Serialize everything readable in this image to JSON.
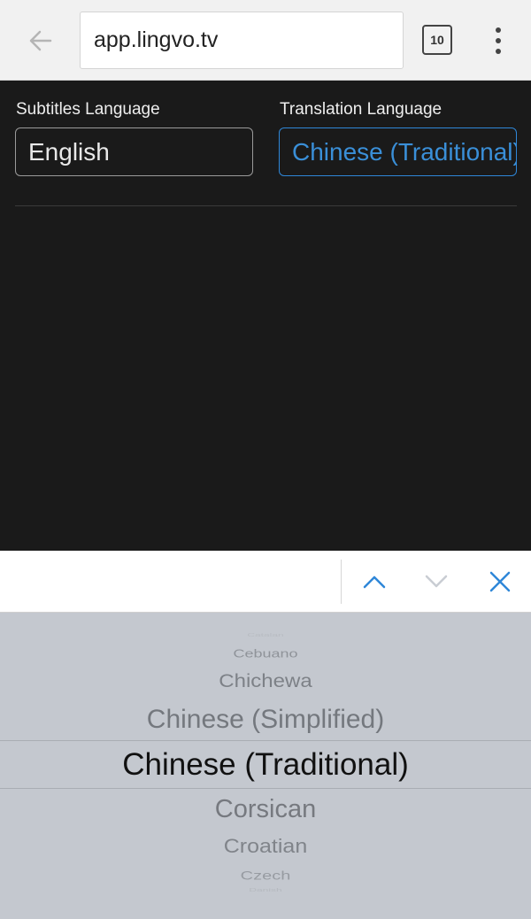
{
  "browser": {
    "url": "app.lingvo.tv",
    "tab_count": "10"
  },
  "form": {
    "subtitles_label": "Subtitles Language",
    "subtitles_value": "English",
    "translation_label": "Translation Language",
    "translation_value": "Chinese (Traditional)"
  },
  "picker": {
    "options": [
      "Catalan",
      "Cebuano",
      "Chichewa",
      "Chinese (Simplified)",
      "Chinese (Traditional)",
      "Corsican",
      "Croatian",
      "Czech",
      "Danish"
    ],
    "selected": "Chinese (Traditional)"
  },
  "colors": {
    "accent": "#2f87d8",
    "page_background": "#1a1a1a",
    "picker_background": "#c4c8cf"
  }
}
